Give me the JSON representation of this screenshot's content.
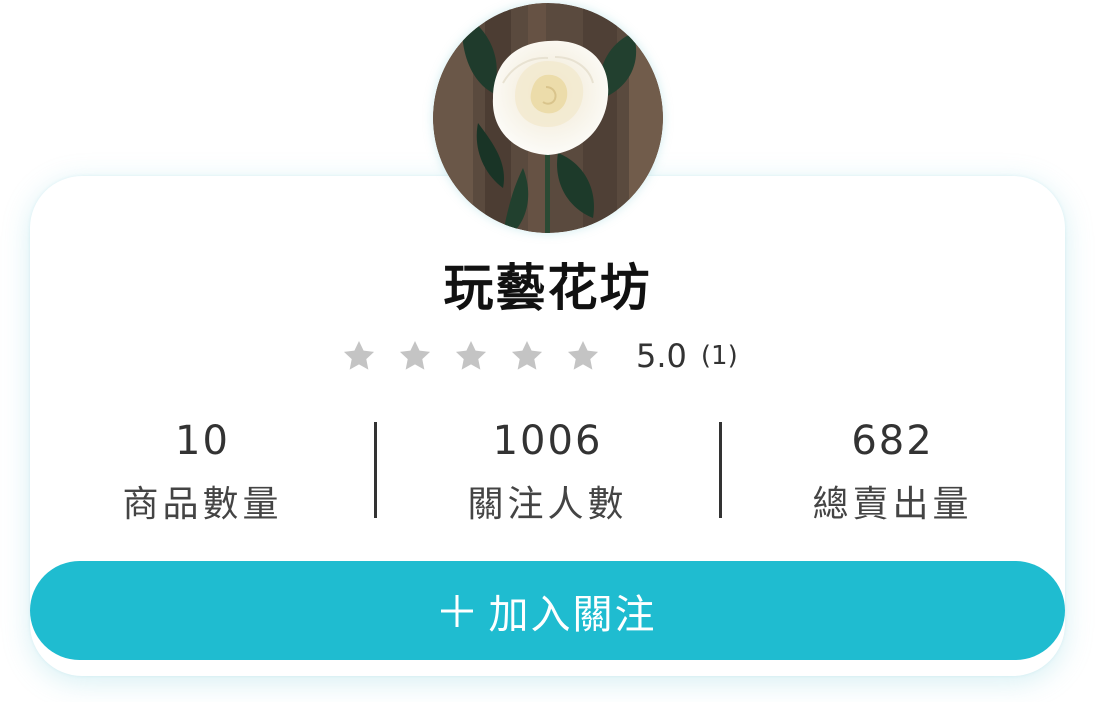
{
  "shop": {
    "name": "玩藝花坊",
    "avatar_icon": "white-rose-photo",
    "rating": {
      "stars_total": 5,
      "value": "5.0",
      "count": "(1)",
      "star_color": "#c4c4c4"
    }
  },
  "stats": [
    {
      "value": "10",
      "label": "商品數量"
    },
    {
      "value": "1006",
      "label": "關注人數"
    },
    {
      "value": "682",
      "label": "總賣出量"
    }
  ],
  "follow_button": {
    "label": "加入關注",
    "icon": "plus-icon",
    "color": "#1fbcd0"
  }
}
